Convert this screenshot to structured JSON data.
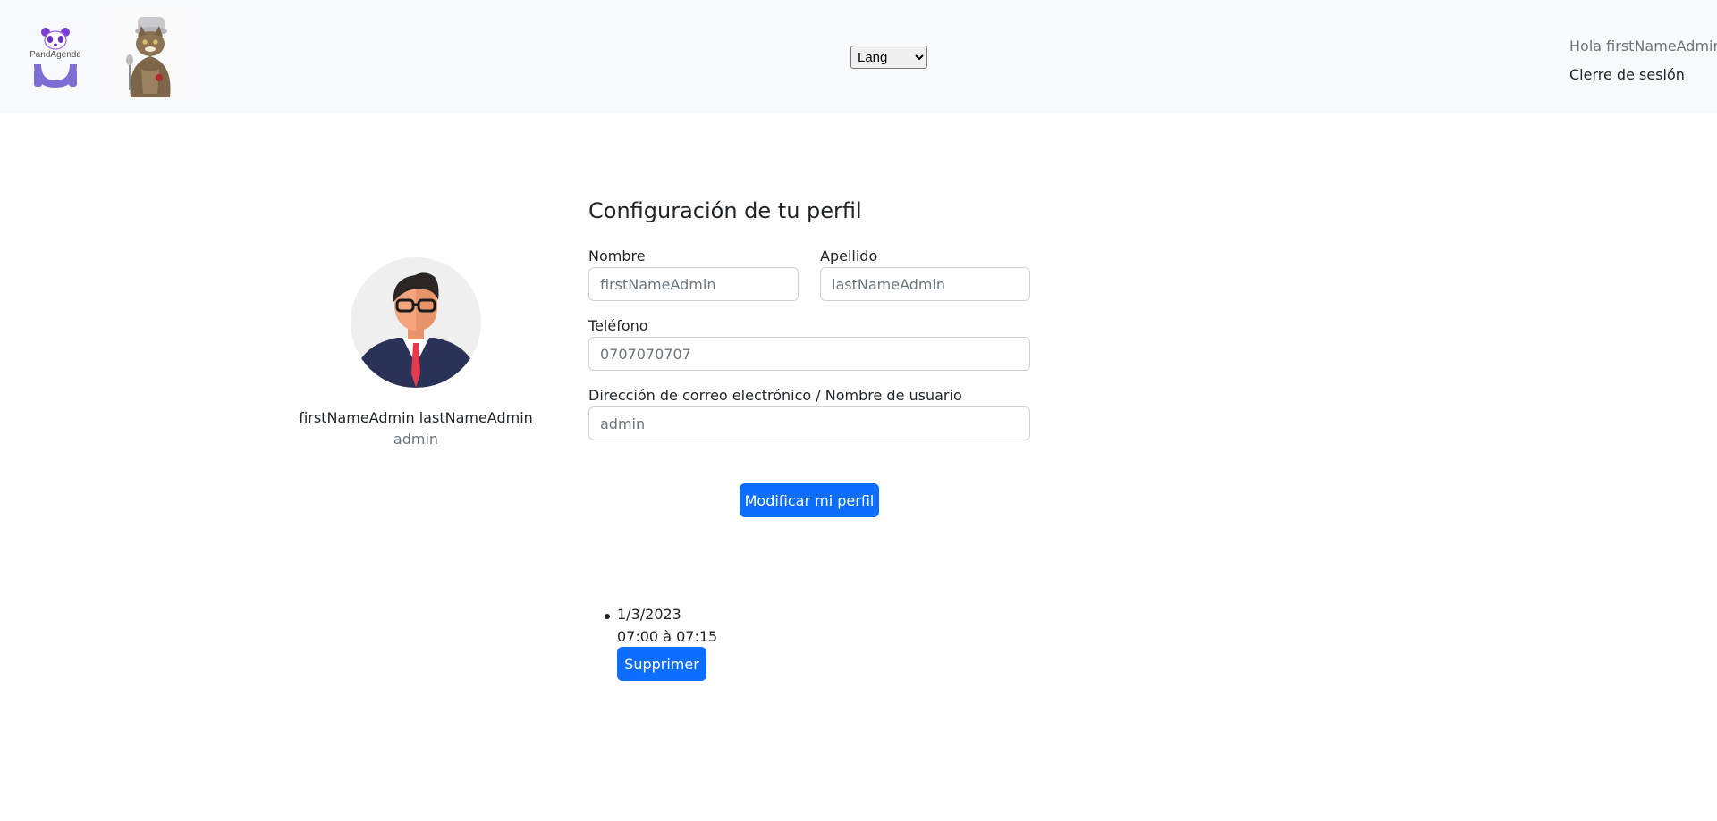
{
  "header": {
    "logo_text": "PandAgenda",
    "lang_select": {
      "selected": "Lang",
      "options": [
        "Lang"
      ]
    },
    "greeting": "Hola firstNameAdmin",
    "logout_label": "Cierre de sesión"
  },
  "profile_card": {
    "full_name": "firstNameAdmin lastNameAdmin",
    "role": "admin"
  },
  "settings_form": {
    "title": "Configuración de tu perfil",
    "first_name": {
      "label": "Nombre",
      "placeholder": "firstNameAdmin"
    },
    "last_name": {
      "label": "Apellido",
      "placeholder": "lastNameAdmin"
    },
    "phone": {
      "label": "Teléfono",
      "placeholder": "0707070707"
    },
    "email": {
      "label": "Dirección de correo electrónico / Nombre de usuario",
      "placeholder": "admin"
    },
    "submit_label": "Modificar mi perfil"
  },
  "appointments": [
    {
      "date": "1/3/2023",
      "time": "07:00 à 07:15",
      "delete_label": "Supprimer"
    }
  ]
}
